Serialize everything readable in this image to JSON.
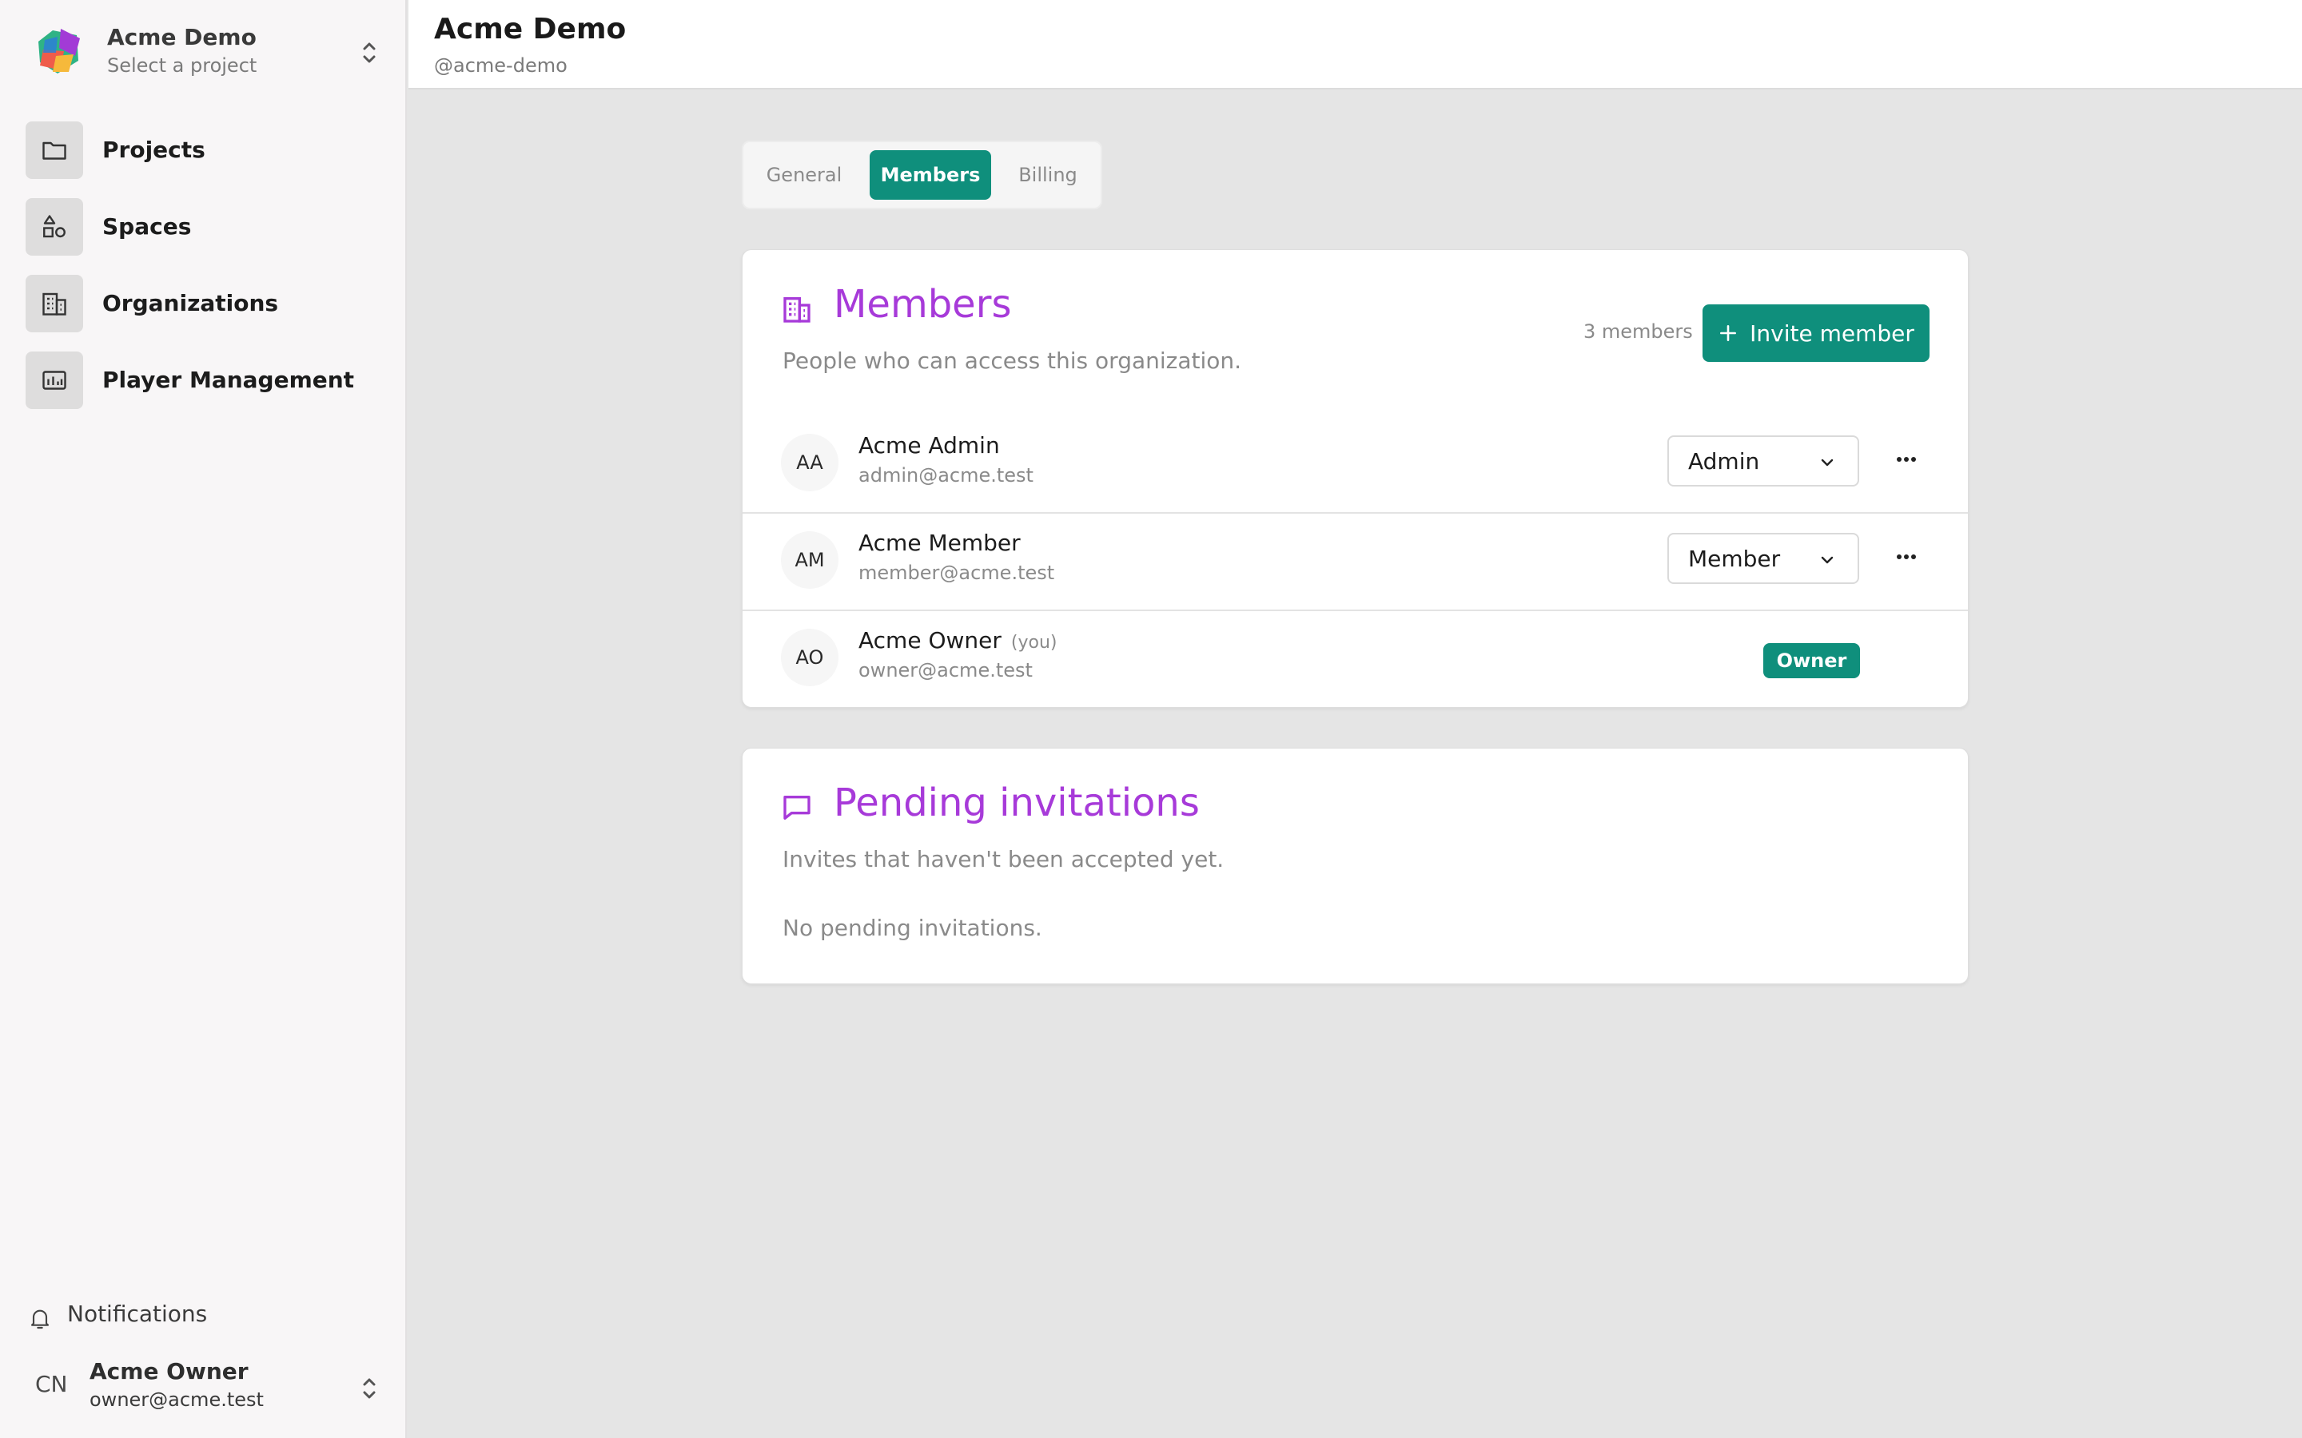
{
  "sidebar": {
    "brand_name": "Acme Demo",
    "brand_sub": "Select a project",
    "items": [
      {
        "label": "Projects",
        "icon": "folder-icon"
      },
      {
        "label": "Spaces",
        "icon": "shapes-icon"
      },
      {
        "label": "Organizations",
        "icon": "building-icon"
      },
      {
        "label": "Player Management",
        "icon": "dashboard-icon"
      }
    ],
    "notifications_label": "Notifications",
    "user": {
      "initials": "CN",
      "name": "Acme Owner",
      "email": "owner@acme.test"
    }
  },
  "header": {
    "title": "Acme Demo",
    "handle": "@acme-demo"
  },
  "tabs": [
    {
      "label": "General",
      "active": false
    },
    {
      "label": "Members",
      "active": true
    },
    {
      "label": "Billing",
      "active": false
    }
  ],
  "members_card": {
    "title": "Members",
    "subtitle": "People who can access this organization.",
    "count": "3 members",
    "invite_label": "Invite member",
    "rows": [
      {
        "initials": "AA",
        "name": "Acme Admin",
        "you": "",
        "email": "admin@acme.test",
        "role": "Admin"
      },
      {
        "initials": "AM",
        "name": "Acme Member",
        "you": "",
        "email": "member@acme.test",
        "role": "Member"
      },
      {
        "initials": "AO",
        "name": "Acme Owner",
        "you": "(you)",
        "email": "owner@acme.test",
        "badge": "Owner"
      }
    ]
  },
  "pending_card": {
    "title": "Pending invitations",
    "subtitle": "Invites that haven't been accepted yet.",
    "empty": "No pending invitations."
  },
  "colors": {
    "accent": "#0f8f7c",
    "heading": "#a73ad9"
  }
}
